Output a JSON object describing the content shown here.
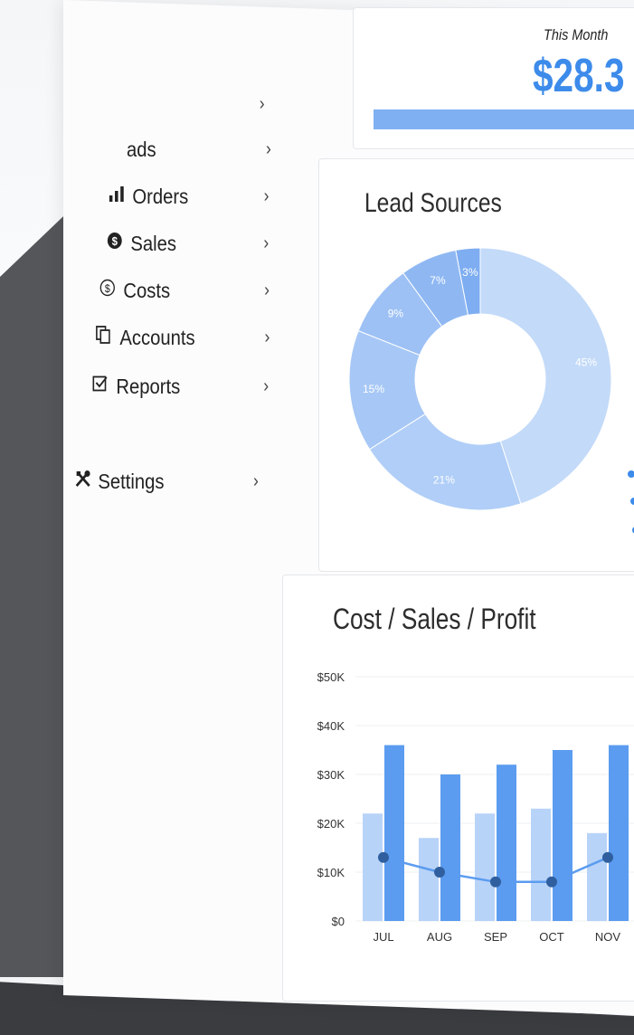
{
  "sidebar": {
    "items": [
      {
        "label": "",
        "icon": "chevron-right-icon"
      },
      {
        "label": "ads",
        "icon": ""
      },
      {
        "label": "Orders",
        "icon": "bar-chart-icon"
      },
      {
        "label": "Sales",
        "icon": "dollar-circle-icon"
      },
      {
        "label": "Costs",
        "icon": "dollar-outline-icon"
      },
      {
        "label": "Accounts",
        "icon": "copy-icon"
      },
      {
        "label": "Reports",
        "icon": "checkbox-icon"
      },
      {
        "label": "Settings",
        "icon": "tools-icon"
      }
    ],
    "chevron": "›"
  },
  "summary": {
    "label": "This Month",
    "value": "$28.3"
  },
  "lead_sources": {
    "title": "Lead Sources"
  },
  "cost_sales_profit": {
    "title": "Cost / Sales / Profit"
  },
  "colors": {
    "accent": "#3d8bea",
    "light_blue": "#b8d3f8",
    "mid_blue": "#5b9cf0",
    "dark_blue": "#2f5f9e"
  },
  "chart_data": [
    {
      "type": "pie",
      "title": "Lead Sources",
      "labels": [
        "45%",
        "21%",
        "15%",
        "9%",
        "7%",
        "3%"
      ],
      "values": [
        45,
        21,
        15,
        9,
        7,
        3
      ]
    },
    {
      "type": "bar",
      "title": "Cost / Sales / Profit",
      "categories": [
        "JUL",
        "AUG",
        "SEP",
        "OCT",
        "NOV"
      ],
      "y_tick_labels": [
        "$0",
        "$10K",
        "$20K",
        "$30K",
        "$40K",
        "$50K"
      ],
      "ylim": [
        0,
        50000
      ],
      "series": [
        {
          "values": [
            22000,
            17000,
            22000,
            23000,
            18000
          ]
        },
        {
          "values": [
            36000,
            30000,
            32000,
            35000,
            36000
          ]
        },
        {
          "values": [
            13000,
            10000,
            8000,
            8000,
            13000
          ]
        }
      ]
    }
  ]
}
